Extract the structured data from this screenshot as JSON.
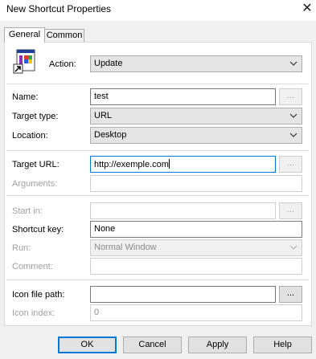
{
  "window": {
    "title": "New Shortcut Properties"
  },
  "tabs": [
    {
      "label": "General"
    },
    {
      "label": "Common"
    }
  ],
  "general": {
    "action": {
      "label": "Action:",
      "value": "Update"
    },
    "name": {
      "label": "Name:",
      "value": "test"
    },
    "target_type": {
      "label": "Target type:",
      "value": "URL"
    },
    "location": {
      "label": "Location:",
      "value": "Desktop"
    },
    "target_url": {
      "label": "Target URL:",
      "value": "http://exemple.com"
    },
    "arguments": {
      "label": "Arguments:",
      "value": ""
    },
    "start_in": {
      "label": "Start in:",
      "value": ""
    },
    "shortcut_key": {
      "label": "Shortcut key:",
      "value": "None"
    },
    "run": {
      "label": "Run:",
      "value": "Normal Window"
    },
    "comment": {
      "label": "Comment:",
      "value": ""
    },
    "icon_file_path": {
      "label": "Icon file path:",
      "value": ""
    },
    "icon_index": {
      "label": "Icon index:",
      "value": "0"
    },
    "browse_label": "..."
  },
  "buttons": {
    "ok": "OK",
    "cancel": "Cancel",
    "apply": "Apply",
    "help": "Help"
  },
  "colors": {
    "focus": "#0078d7",
    "window": "#f0f0f0",
    "panel": "#ffffff"
  }
}
